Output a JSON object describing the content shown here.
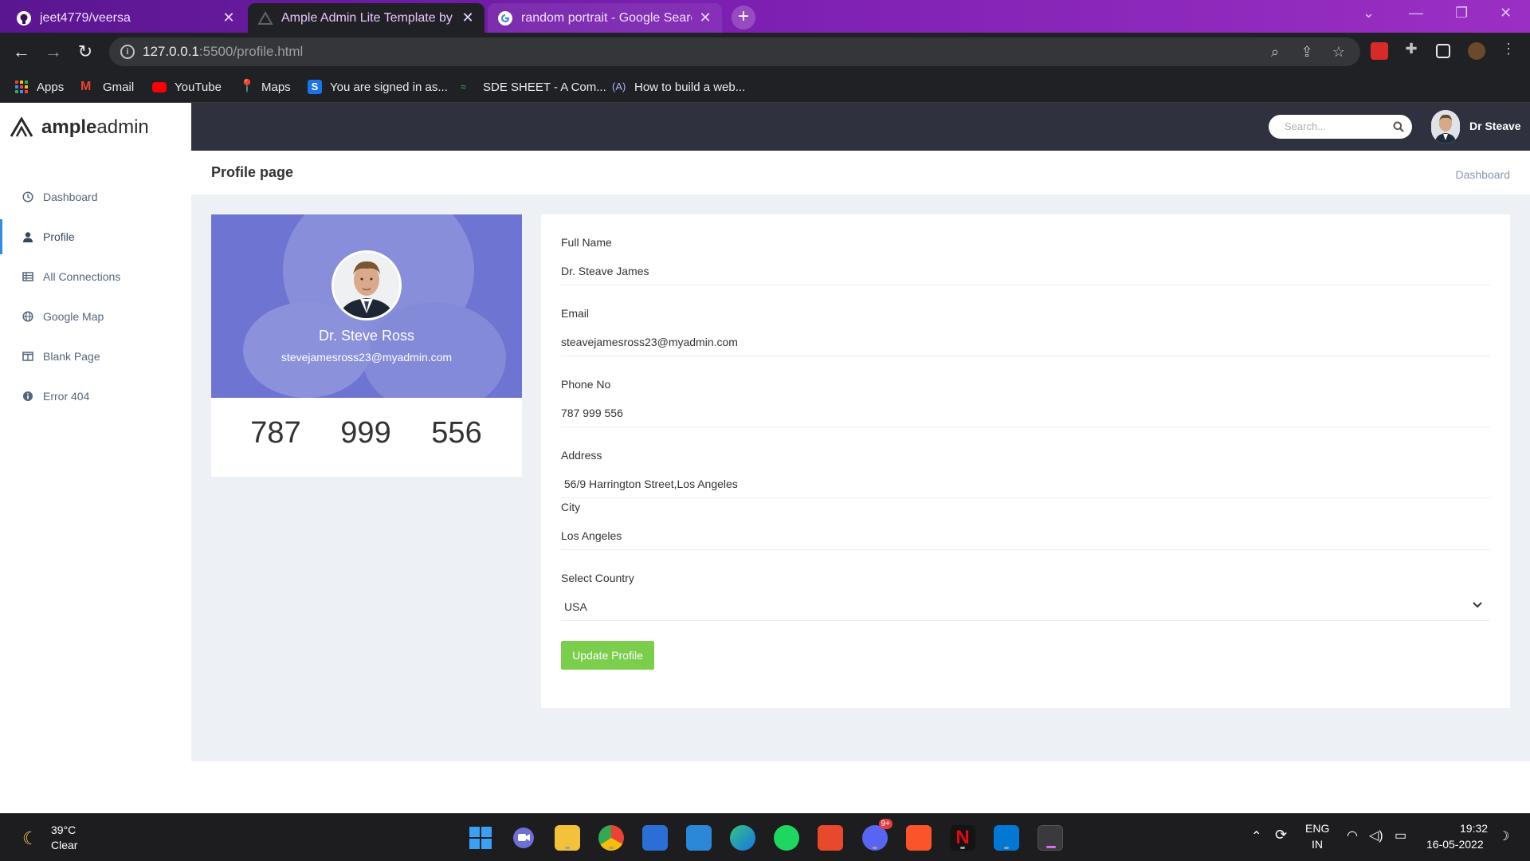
{
  "browser": {
    "tabs": [
      {
        "title": "jeet4779/veersa"
      },
      {
        "title": "Ample Admin Lite Template by W"
      },
      {
        "title": "random portrait - Google Search"
      }
    ],
    "url_host": "127.0.0.1",
    "url_path": ":5500/profile.html",
    "bookmarks": [
      {
        "label": "Apps"
      },
      {
        "label": "Gmail"
      },
      {
        "label": "YouTube"
      },
      {
        "label": "Maps"
      },
      {
        "label": "You are signed in as..."
      },
      {
        "label": "SDE SHEET - A Com..."
      },
      {
        "label": "How to build a web..."
      }
    ]
  },
  "app": {
    "logo_bold": "ample",
    "logo_light": "admin",
    "sidebar": [
      {
        "label": "Dashboard",
        "icon": "clock-icon"
      },
      {
        "label": "Profile",
        "icon": "user-icon",
        "active": true
      },
      {
        "label": "All Connections",
        "icon": "table-icon"
      },
      {
        "label": "Google Map",
        "icon": "globe-icon"
      },
      {
        "label": "Blank Page",
        "icon": "columns-icon"
      },
      {
        "label": "Error 404",
        "icon": "info-circle-icon"
      }
    ],
    "search_placeholder": "Search...",
    "user_name": "Dr Steave",
    "page_title": "Profile page",
    "breadcrumb": "Dashboard",
    "accent_color": "#2f8be6",
    "banner_color": "#6d74d1",
    "button_color": "#7ace4c"
  },
  "profile": {
    "name": "Dr. Steve Ross",
    "email": "stevejamesross23@myadmin.com",
    "stats": [
      "787",
      "999",
      "556"
    ]
  },
  "form": {
    "full_name_label": "Full Name",
    "full_name": "Dr. Steave James",
    "email_label": "Email",
    "email": "steavejamesross23@myadmin.com",
    "phone_label": "Phone No",
    "phone": "787 999 556",
    "address_label": "Address",
    "address": " 56/9 Harrington Street,Los Angeles",
    "city_label": "City",
    "city": "Los Angeles",
    "country_label": "Select Country",
    "country": "USA",
    "update_button": "Update Profile"
  },
  "taskbar": {
    "weather_temp": "39°C",
    "weather_desc": "Clear",
    "language": "ENG",
    "region": "IN",
    "time": "19:32",
    "date": "16-05-2022",
    "discord_badge": "9+"
  }
}
